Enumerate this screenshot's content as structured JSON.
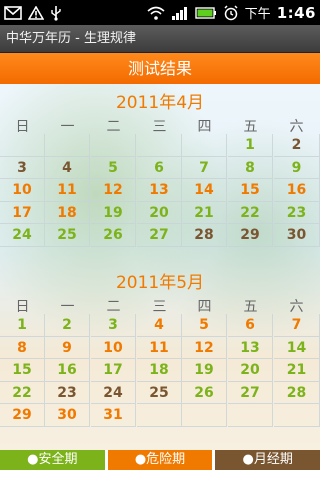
{
  "statusbar": {
    "left_icons": [
      "mail-icon",
      "warning-icon",
      "usb-icon"
    ],
    "right_icons": [
      "wifi-icon",
      "signal-icon",
      "battery-icon",
      "alarm-icon"
    ],
    "ampm": "下午",
    "time": "1:46"
  },
  "titlebar": {
    "title": "中华万年历 - 生理规律"
  },
  "header": {
    "title": "测试结果"
  },
  "weekdays": [
    "日",
    "一",
    "二",
    "三",
    "四",
    "五",
    "六"
  ],
  "colors": {
    "safe": "#7cb31a",
    "danger": "#f07a00",
    "period": "#7a5630"
  },
  "months": [
    {
      "title": "2011年4月",
      "rows": [
        [
          null,
          null,
          null,
          null,
          null,
          {
            "d": "1",
            "t": "safe"
          },
          {
            "d": "2",
            "t": "period"
          }
        ],
        [
          {
            "d": "3",
            "t": "period"
          },
          {
            "d": "4",
            "t": "period"
          },
          {
            "d": "5",
            "t": "safe"
          },
          {
            "d": "6",
            "t": "safe"
          },
          {
            "d": "7",
            "t": "safe"
          },
          {
            "d": "8",
            "t": "safe"
          },
          {
            "d": "9",
            "t": "safe"
          }
        ],
        [
          {
            "d": "10",
            "t": "danger"
          },
          {
            "d": "11",
            "t": "danger"
          },
          {
            "d": "12",
            "t": "danger"
          },
          {
            "d": "13",
            "t": "danger"
          },
          {
            "d": "14",
            "t": "danger"
          },
          {
            "d": "15",
            "t": "danger"
          },
          {
            "d": "16",
            "t": "danger"
          }
        ],
        [
          {
            "d": "17",
            "t": "danger"
          },
          {
            "d": "18",
            "t": "danger"
          },
          {
            "d": "19",
            "t": "safe"
          },
          {
            "d": "20",
            "t": "safe"
          },
          {
            "d": "21",
            "t": "safe"
          },
          {
            "d": "22",
            "t": "safe"
          },
          {
            "d": "23",
            "t": "safe"
          }
        ],
        [
          {
            "d": "24",
            "t": "safe"
          },
          {
            "d": "25",
            "t": "safe"
          },
          {
            "d": "26",
            "t": "safe"
          },
          {
            "d": "27",
            "t": "safe"
          },
          {
            "d": "28",
            "t": "period"
          },
          {
            "d": "29",
            "t": "period"
          },
          {
            "d": "30",
            "t": "period"
          }
        ]
      ]
    },
    {
      "title": "2011年5月",
      "rows": [
        [
          {
            "d": "1",
            "t": "safe"
          },
          {
            "d": "2",
            "t": "safe"
          },
          {
            "d": "3",
            "t": "safe"
          },
          {
            "d": "4",
            "t": "danger"
          },
          {
            "d": "5",
            "t": "danger"
          },
          {
            "d": "6",
            "t": "danger"
          },
          {
            "d": "7",
            "t": "danger"
          }
        ],
        [
          {
            "d": "8",
            "t": "danger"
          },
          {
            "d": "9",
            "t": "danger"
          },
          {
            "d": "10",
            "t": "danger"
          },
          {
            "d": "11",
            "t": "danger"
          },
          {
            "d": "12",
            "t": "danger"
          },
          {
            "d": "13",
            "t": "safe"
          },
          {
            "d": "14",
            "t": "safe"
          }
        ],
        [
          {
            "d": "15",
            "t": "safe"
          },
          {
            "d": "16",
            "t": "safe"
          },
          {
            "d": "17",
            "t": "safe"
          },
          {
            "d": "18",
            "t": "safe"
          },
          {
            "d": "19",
            "t": "safe"
          },
          {
            "d": "20",
            "t": "safe"
          },
          {
            "d": "21",
            "t": "safe"
          }
        ],
        [
          {
            "d": "22",
            "t": "safe"
          },
          {
            "d": "23",
            "t": "period"
          },
          {
            "d": "24",
            "t": "period"
          },
          {
            "d": "25",
            "t": "period"
          },
          {
            "d": "26",
            "t": "safe"
          },
          {
            "d": "27",
            "t": "safe"
          },
          {
            "d": "28",
            "t": "safe"
          }
        ],
        [
          {
            "d": "29",
            "t": "danger"
          },
          {
            "d": "30",
            "t": "danger"
          },
          {
            "d": "31",
            "t": "danger"
          },
          null,
          null,
          null,
          null
        ]
      ]
    }
  ],
  "legend": [
    {
      "label": "●安全期",
      "color": "#7cb31a"
    },
    {
      "label": "●危险期",
      "color": "#f07a00"
    },
    {
      "label": "●月经期",
      "color": "#7a5630"
    }
  ]
}
